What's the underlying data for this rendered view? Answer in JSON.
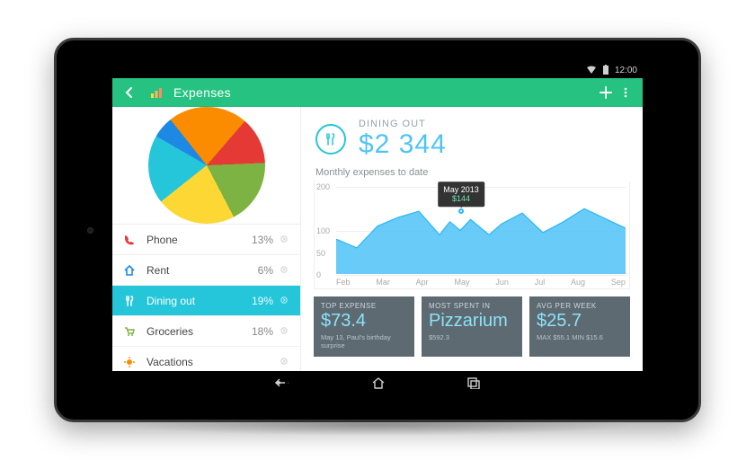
{
  "status": {
    "time": "12:00"
  },
  "actionbar": {
    "title": "Expenses"
  },
  "categories": [
    {
      "id": "phone",
      "label": "Phone",
      "pct": "13%",
      "color": "#e53935",
      "icon": "phone"
    },
    {
      "id": "rent",
      "label": "Rent",
      "pct": "6%",
      "color": "#1e88e5",
      "icon": "home"
    },
    {
      "id": "dining",
      "label": "Dining out",
      "pct": "19%",
      "color": "#26c6da",
      "icon": "dining",
      "selected": true
    },
    {
      "id": "groceries",
      "label": "Groceries",
      "pct": "18%",
      "color": "#7cb342",
      "icon": "cart"
    },
    {
      "id": "vacations",
      "label": "Vacations",
      "pct": "",
      "color": "#fb8c00",
      "icon": "sun"
    }
  ],
  "pie_slices": [
    {
      "label": "Rent",
      "pct": 6,
      "color": "#1e88e5"
    },
    {
      "label": "Vacations",
      "pct": 22,
      "color": "#fb8c00"
    },
    {
      "label": "Phone",
      "pct": 13,
      "color": "#e53935"
    },
    {
      "label": "Groceries",
      "pct": 18,
      "color": "#7cb342"
    },
    {
      "label": "Other",
      "pct": 22,
      "color": "#fdd835"
    },
    {
      "label": "Dining out",
      "pct": 19,
      "color": "#26c6da"
    }
  ],
  "detail": {
    "label": "DINING OUT",
    "amount": "$2 344"
  },
  "chart_data": {
    "type": "area",
    "title": "Monthly expenses to date",
    "ylabel": "",
    "ylim": [
      0,
      200
    ],
    "yticks": [
      0,
      50,
      100,
      200
    ],
    "categories": [
      "Feb",
      "Mar",
      "Apr",
      "May",
      "Jun",
      "Jul",
      "Aug",
      "Sep"
    ],
    "values": [
      80,
      60,
      110,
      130,
      144,
      90,
      120,
      100,
      125,
      90,
      115,
      140,
      95,
      120,
      150,
      105
    ],
    "x_for_values": [
      0,
      0.5,
      1.0,
      1.5,
      2.0,
      2.5,
      2.75,
      3.0,
      3.25,
      3.7,
      4.0,
      4.5,
      5.0,
      5.5,
      6.0,
      7.0
    ],
    "tooltip": {
      "x_index": 3.0,
      "label": "May 2013",
      "value": "$144",
      "y": 144
    }
  },
  "cards": [
    {
      "title": "TOP EXPENSE",
      "value": "$73.4",
      "note": "May 13, Paul's birthday surprise"
    },
    {
      "title": "MOST SPENT IN",
      "value": "Pizzarium",
      "note": "$592.3"
    },
    {
      "title": "AVG PER WEEK",
      "value": "$25.7",
      "note": "MAX $55.1   MIN $15.6"
    }
  ]
}
